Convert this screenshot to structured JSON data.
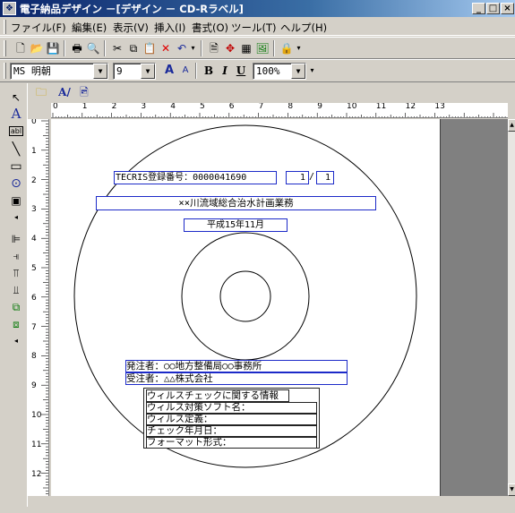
{
  "window": {
    "title": "電子納品デザイン －[デザイン － CD-Rラベル]",
    "min_glyph": "_",
    "max_glyph": "□",
    "close_glyph": "×"
  },
  "menu": {
    "items": [
      "ファイル(F)",
      "編集(E)",
      "表示(V)",
      "挿入(I)",
      "書式(O)",
      "ツール(T)",
      "ヘルプ(H)"
    ]
  },
  "format_toolbar": {
    "font_name": "MS 明朝",
    "font_size": "9",
    "zoom": "100%",
    "bold_label": "B",
    "italic_label": "I",
    "underline_label": "U",
    "grow_label": "A",
    "shrink_label": "A"
  },
  "palette": {
    "text_label": "A",
    "textbox_label": "abl"
  },
  "inner_toolbar": {
    "text_style_label": "A/"
  },
  "rulers": {
    "h_numbers": [
      "0",
      "1",
      "2",
      "3",
      "4",
      "5",
      "6",
      "7",
      "8",
      "9",
      "10",
      "11",
      "12",
      "13"
    ],
    "v_numbers": [
      "0",
      "1",
      "2",
      "3",
      "4",
      "5",
      "6",
      "7",
      "8",
      "9",
      "10",
      "11",
      "12"
    ]
  },
  "label": {
    "tecris_label": "TECRIS登録番号：",
    "tecris_value": "0000041690",
    "disc_number": "1",
    "disc_total": "1",
    "disc_sep": "/",
    "project_name": "××川流域総合治水計画業務",
    "date": "平成15年11月",
    "orderer": "発注者：○○地方整備局○○事務所",
    "contractor": "受注者：△△株式会社",
    "virus_header": "ウィルスチェックに関する情報",
    "virus_software_label": "ウィルス対策ソフト名：",
    "virus_definition_label": "ウィルス定義：",
    "check_date_label": "チェック年月日：",
    "format_label": "フォーマット形式："
  }
}
